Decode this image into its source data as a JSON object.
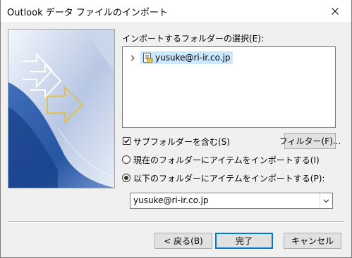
{
  "window": {
    "title": "Outlook データ ファイルのインポート"
  },
  "folder_select": {
    "label": "インポートするフォルダーの選択(E):",
    "tree_item": "yusuke@ri-ir.co.jp"
  },
  "options": {
    "include_subfolders_label": "サブフォルダーを含む(S)",
    "include_subfolders_checked": true,
    "filter_button": "フィルター(F)...",
    "radio_current_label": "現在のフォルダーにアイテムをインポートする(I)",
    "radio_current_selected": false,
    "radio_below_label": "以下のフォルダーにアイテムをインポートする(P):",
    "radio_below_selected": true,
    "target_folder_value": "yusuke@ri-ir.co.jp"
  },
  "buttons": {
    "back": "< 戻る(B)",
    "finish": "完了",
    "cancel": "キャンセル"
  },
  "colors": {
    "selection": "#cce8ff",
    "default_button_border": "#0078d7",
    "wizard_blue": "#1f4f9f"
  }
}
